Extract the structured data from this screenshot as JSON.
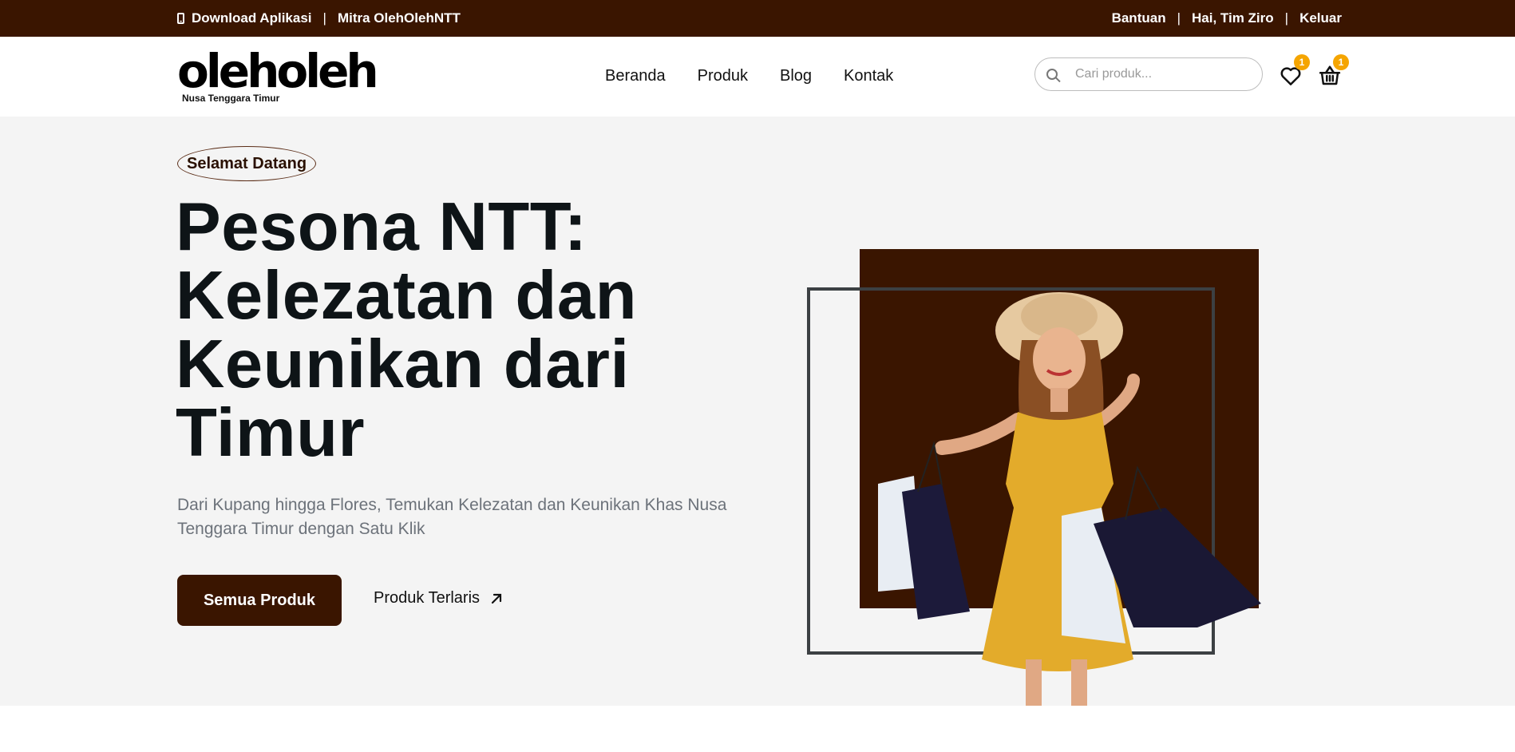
{
  "topbar": {
    "download_app": "Download Aplikasi",
    "separator": "|",
    "partner": "Mitra OlehOlehNTT",
    "help": "Bantuan",
    "greeting": "Hai, Tim Ziro",
    "logout": "Keluar"
  },
  "header": {
    "logo_main": "oleholeh",
    "logo_sub": "Nusa Tenggara Timur",
    "nav": [
      "Beranda",
      "Produk",
      "Blog",
      "Kontak"
    ],
    "search_placeholder": "Cari produk...",
    "wishlist_count": "1",
    "cart_count": "1"
  },
  "hero": {
    "badge": "Selamat Datang",
    "title": "Pesona NTT: Kelezatan dan Keunikan dari Timur",
    "description": "Dari Kupang hingga Flores, Temukan Kelezatan dan Keunikan Khas Nusa Tenggara Timur dengan Satu Klik",
    "primary_button": "Semua Produk",
    "secondary_link": "Produk Terlaris"
  },
  "colors": {
    "brand_brown": "#3a1500",
    "badge_orange": "#f5a500",
    "hero_bg": "#f4f4f4",
    "dress_yellow": "#e3ab2b"
  },
  "icons": [
    "phone-icon",
    "search-icon",
    "heart-icon",
    "basket-icon",
    "arrow-up-right-icon"
  ]
}
